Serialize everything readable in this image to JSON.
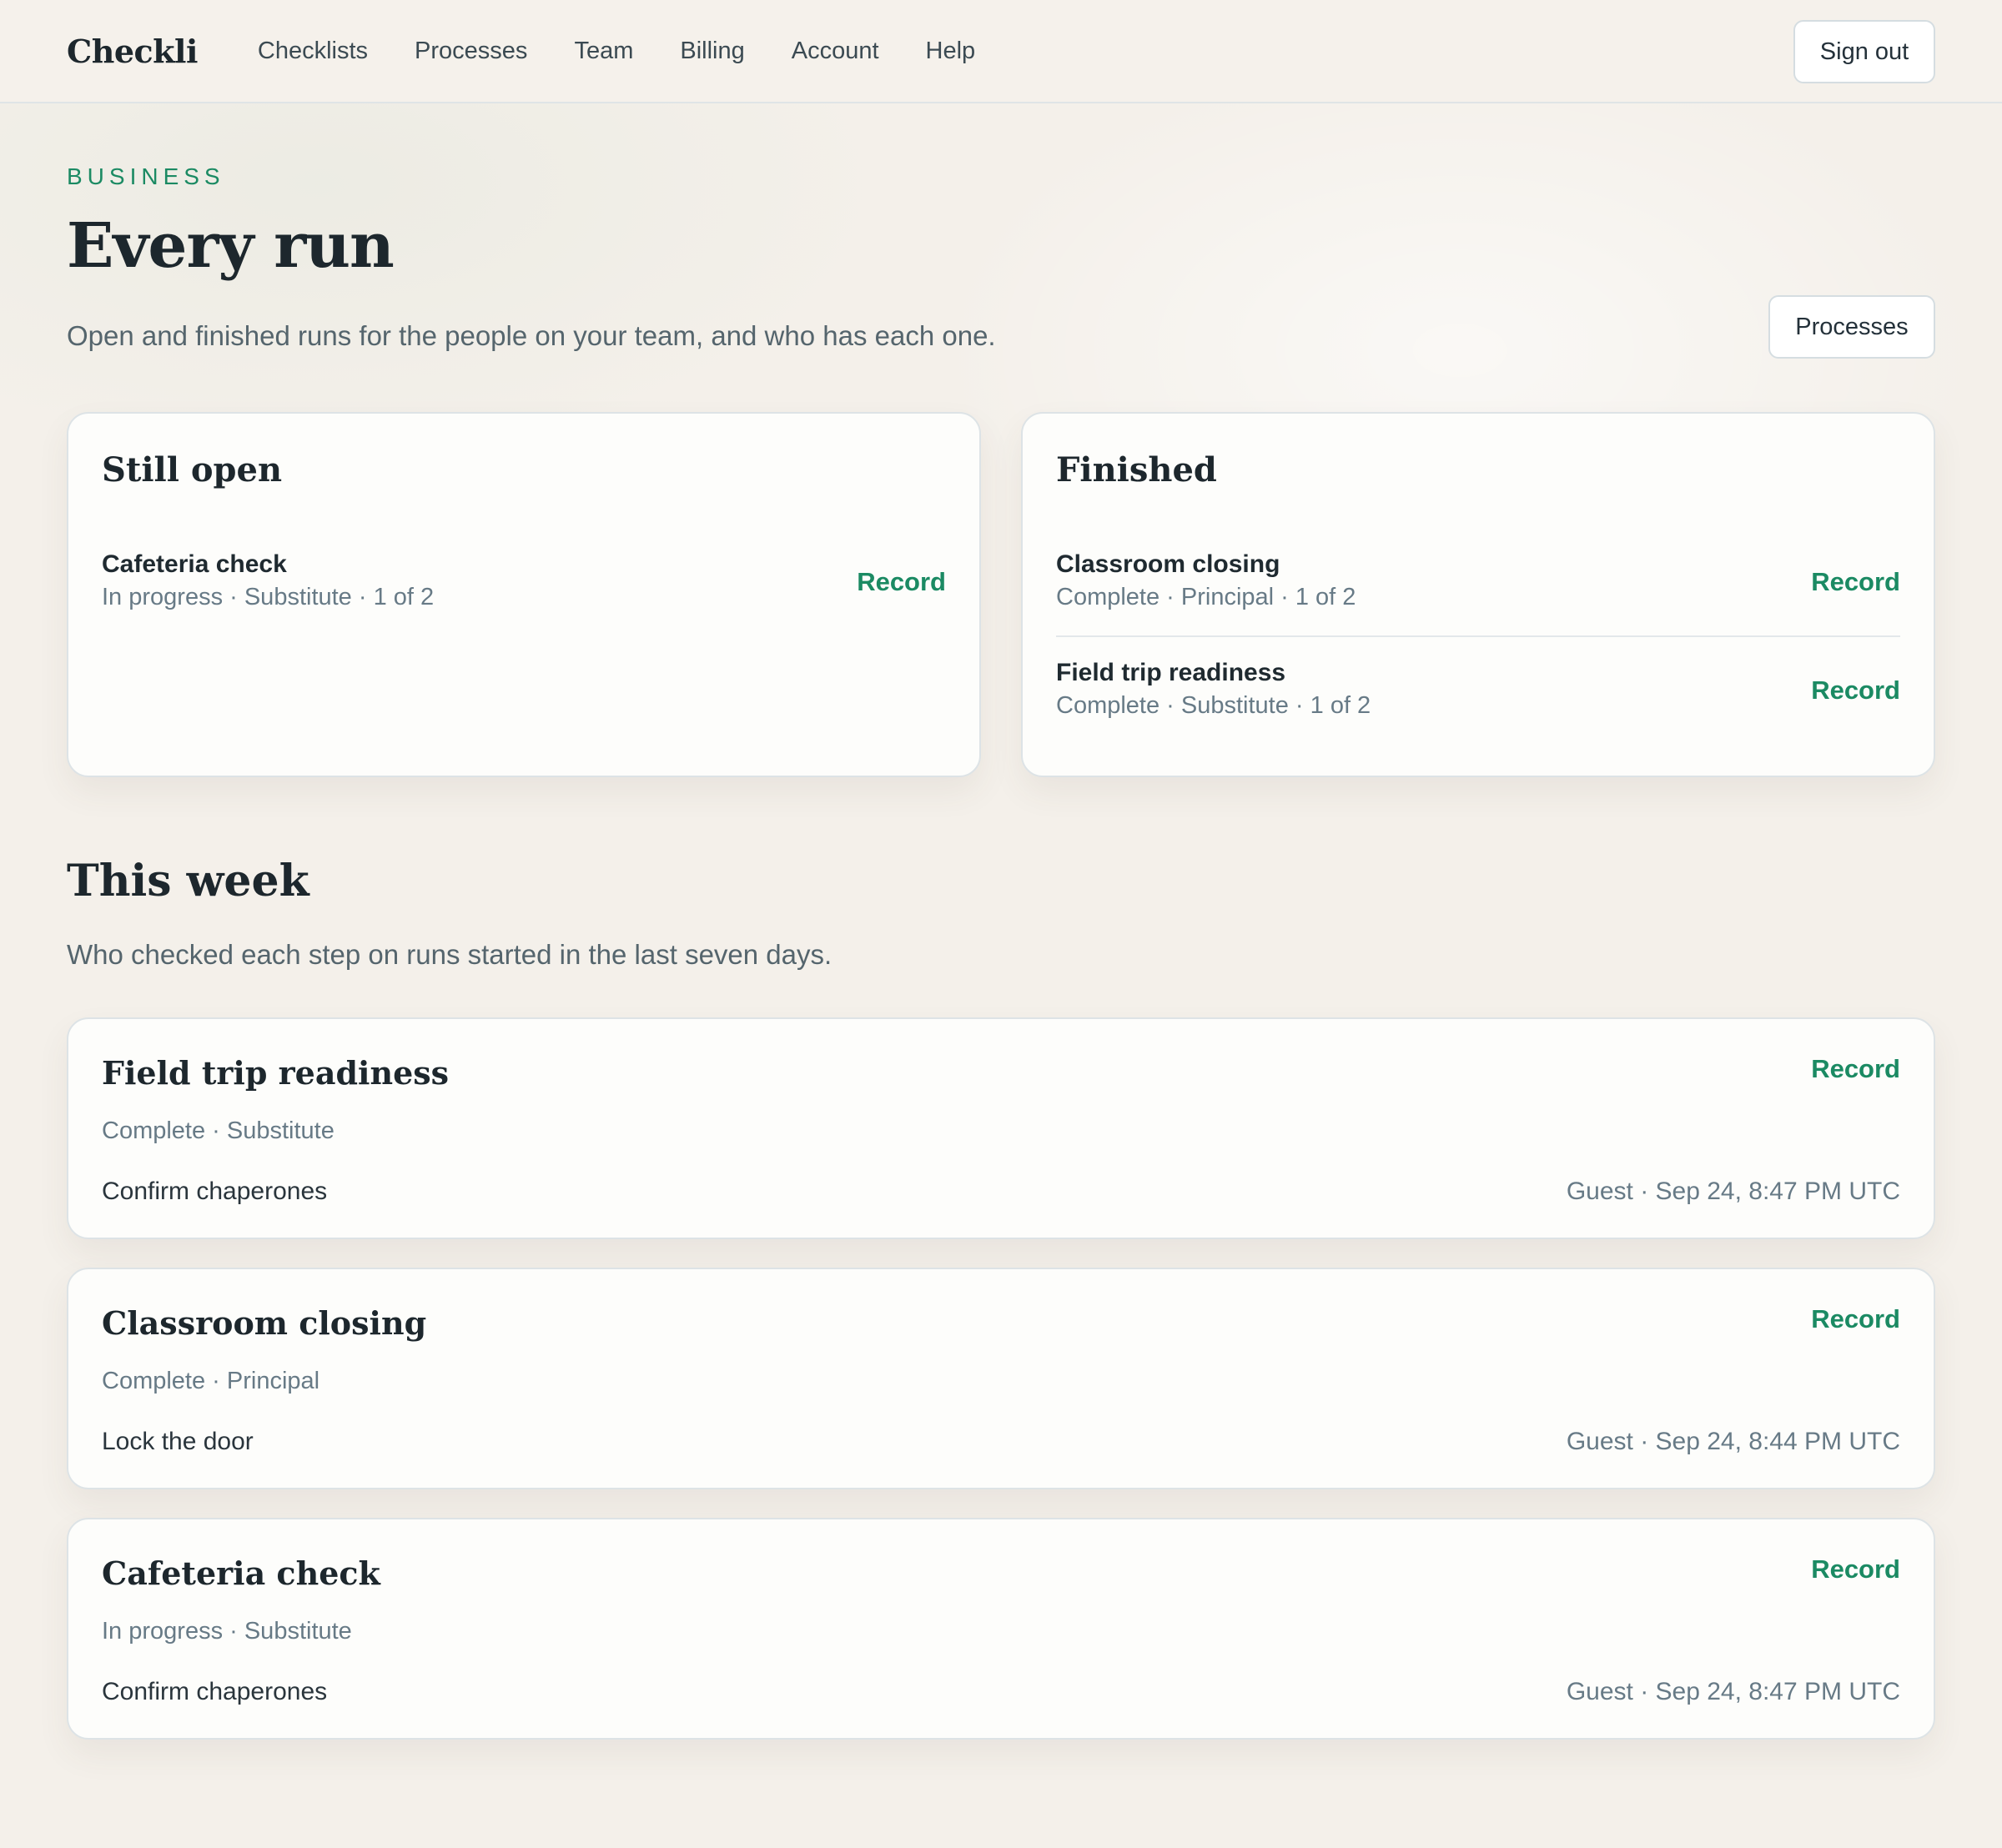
{
  "app": {
    "brand": "Checkli"
  },
  "nav": {
    "items": [
      {
        "label": "Checklists"
      },
      {
        "label": "Processes"
      },
      {
        "label": "Team"
      },
      {
        "label": "Billing"
      },
      {
        "label": "Account"
      },
      {
        "label": "Help"
      }
    ],
    "sign_out": "Sign out"
  },
  "hero": {
    "eyebrow": "BUSINESS",
    "title": "Every run",
    "subtitle": "Open and finished runs for the people on your team, and who has each one.",
    "processes_button": "Processes"
  },
  "open_card": {
    "title": "Still open",
    "rows": [
      {
        "title": "Cafeteria check",
        "meta": "In progress · Substitute · 1 of 2",
        "action": "Record"
      }
    ]
  },
  "finished_card": {
    "title": "Finished",
    "rows": [
      {
        "title": "Classroom closing",
        "meta": "Complete · Principal · 1 of 2",
        "action": "Record"
      },
      {
        "title": "Field trip readiness",
        "meta": "Complete · Substitute · 1 of 2",
        "action": "Record"
      }
    ]
  },
  "this_week": {
    "title": "This week",
    "subtitle": "Who checked each step on runs started in the last seven days.",
    "runs": [
      {
        "title": "Field trip readiness",
        "meta": "Complete · Substitute",
        "step": "Confirm chaperones",
        "who": "Guest · Sep 24, 8:47 PM UTC",
        "action": "Record"
      },
      {
        "title": "Classroom closing",
        "meta": "Complete · Principal",
        "step": "Lock the door",
        "who": "Guest · Sep 24, 8:44 PM UTC",
        "action": "Record"
      },
      {
        "title": "Cafeteria check",
        "meta": "In progress · Substitute",
        "step": "Confirm chaperones",
        "who": "Guest · Sep 24, 8:47 PM UTC",
        "action": "Record"
      }
    ]
  },
  "colors": {
    "accent": "#1b8a63",
    "background": "#f4f0ea",
    "card": "#fdfdfb",
    "text": "#1d272d",
    "muted": "#677a86"
  }
}
